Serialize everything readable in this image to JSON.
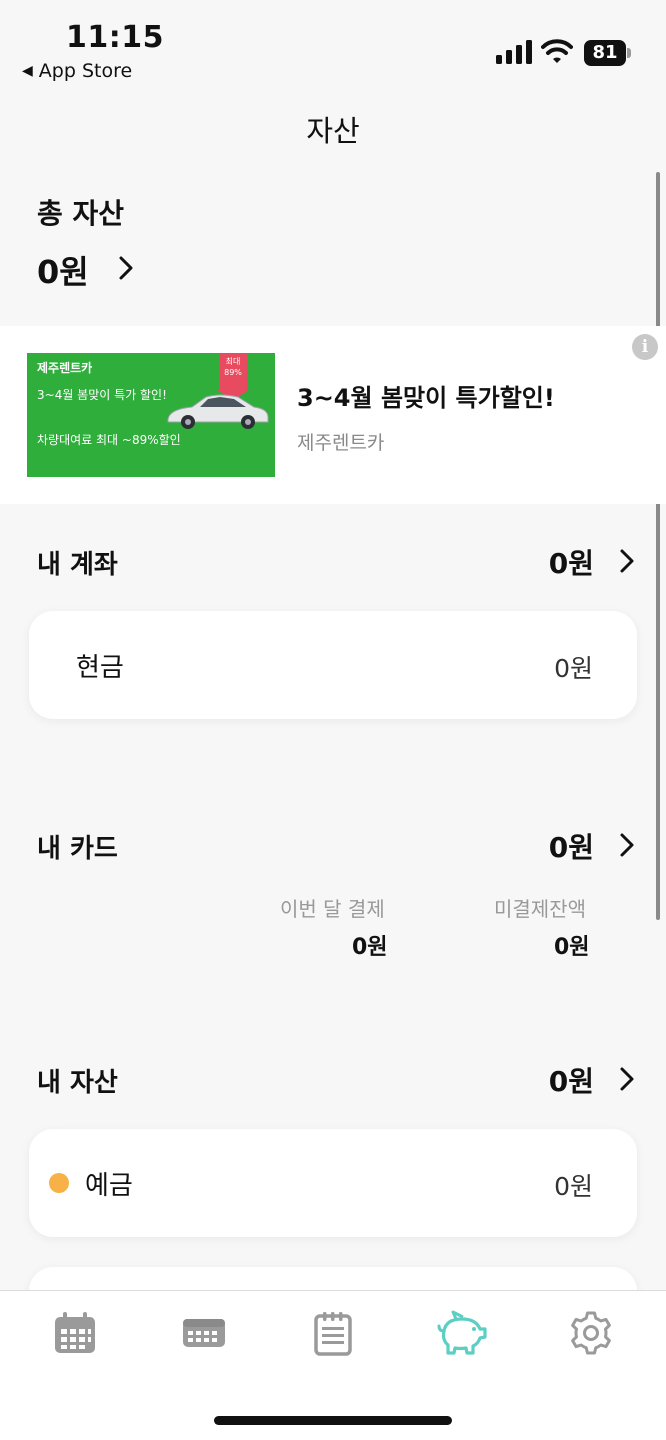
{
  "status_bar": {
    "time": "11:15",
    "back_app": "App Store",
    "battery": "81"
  },
  "nav": {
    "title": "자산"
  },
  "total": {
    "label": "총 자산",
    "value": "0원"
  },
  "ad": {
    "banner_logo": "제주렌트카",
    "banner_line1": "3~4월 봄맞이 특가 할인!",
    "banner_line2": "차량대여료 최대 ~89%할인",
    "badge_line1": "최대",
    "badge_line2": "89%",
    "title": "3~4월 봄맞이 특가할인!",
    "advertiser": "제주렌트카",
    "info_icon": "i"
  },
  "accounts": {
    "label": "내 계좌",
    "value": "0원",
    "items": [
      {
        "label": "현금",
        "value": "0원"
      }
    ]
  },
  "cards": {
    "label": "내 카드",
    "value": "0원",
    "this_month_label": "이번 달 결제",
    "this_month_value": "0원",
    "unpaid_label": "미결제잔액",
    "unpaid_value": "0원"
  },
  "assets": {
    "label": "내 자산",
    "value": "0원",
    "items": [
      {
        "label": "예금",
        "value": "0원",
        "dot_color": "#f8b146"
      }
    ]
  },
  "tabbar": {
    "active_color": "#5ccfc4",
    "inactive_color": "#9a9a9a",
    "tabs": [
      {
        "icon": "calendar-icon",
        "active": false
      },
      {
        "icon": "calendar-week-icon",
        "active": false
      },
      {
        "icon": "notepad-icon",
        "active": false
      },
      {
        "icon": "piggy-bank-icon",
        "active": true
      },
      {
        "icon": "gear-icon",
        "active": false
      }
    ]
  }
}
